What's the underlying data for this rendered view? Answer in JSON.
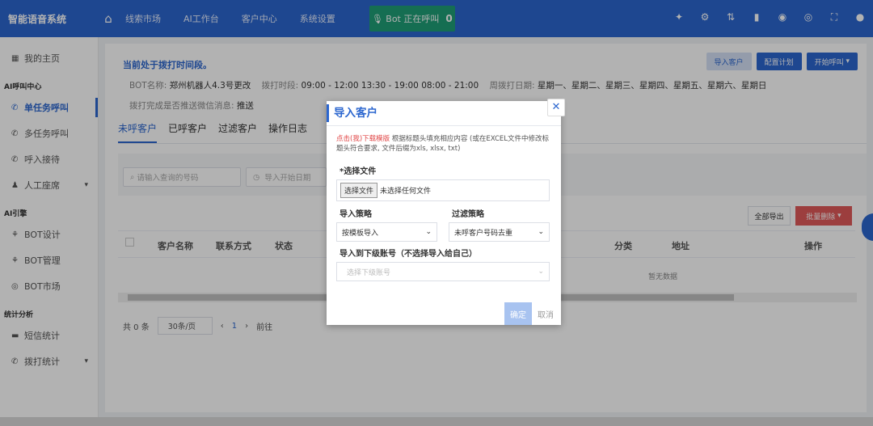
{
  "header": {
    "logo": "智能语音系统",
    "nav": [
      "线索市场",
      "AI工作台",
      "客户中心",
      "系统设置"
    ],
    "call_label": "Bot 正在呼叫",
    "call_count": "0"
  },
  "sidebar": {
    "home": "我的主页",
    "group1": "AI呼叫中心",
    "items1": [
      "单任务呼叫",
      "多任务呼叫",
      "呼入接待",
      "人工座席"
    ],
    "group2": "AI引擎",
    "items2": [
      "BOT设计",
      "BOT管理",
      "BOT市场"
    ],
    "group3": "统计分析",
    "items3": [
      "短信统计",
      "拨打统计"
    ]
  },
  "main": {
    "tip": "当前处于拨打时间段。",
    "bot_name_label": "BOT名称:",
    "bot_name": "郑州机器人4.3号更改",
    "time_label": "拨打时段:",
    "time_value": "09:00 - 12:00 13:30 - 19:00 08:00 - 21:00",
    "days_label": "周拨打日期:",
    "days_value": "星期一、星期二、星期三、星期四、星期五、星期六、星期日",
    "wechat_label": "拨打完成是否推送微信消息:",
    "wechat_value": "推送",
    "btn_import": "导入客户",
    "btn_plan": "配置计划",
    "btn_start": "开始呼叫",
    "tabs": [
      "未呼客户",
      "已呼客户",
      "过滤客户",
      "操作日志"
    ],
    "search_placeholder": "请输入查询的号码",
    "date_placeholder": "导入开始日期",
    "btn_export": "全部导出",
    "btn_batch": "批量删除",
    "columns": [
      "客户名称",
      "联系方式",
      "状态",
      "分类",
      "地址",
      "操作"
    ],
    "nodata": "暂无数据",
    "total": "共 0 条",
    "page_size": "30条/页",
    "page": "1",
    "goto": "前往"
  },
  "modal": {
    "title": "导入客户",
    "desc_link": "点击(我)下载模版",
    "desc": "根据标题头填充相应内容 (或在EXCEL文件中修改标题头符合要求, 文件后缀为xls, xlsx, txt)",
    "file_label": "*选择文件",
    "file_btn": "选择文件",
    "file_none": "未选择任何文件",
    "strategy_label": "导入策略",
    "strategy_value": "按模板导入",
    "filter_label": "过滤策略",
    "filter_value": "未呼客户号码去重",
    "sub_label": "导入到下级账号（不选择导入给自己）",
    "sub_placeholder": "选择下级账号",
    "ok": "确定",
    "cancel": "取消"
  }
}
